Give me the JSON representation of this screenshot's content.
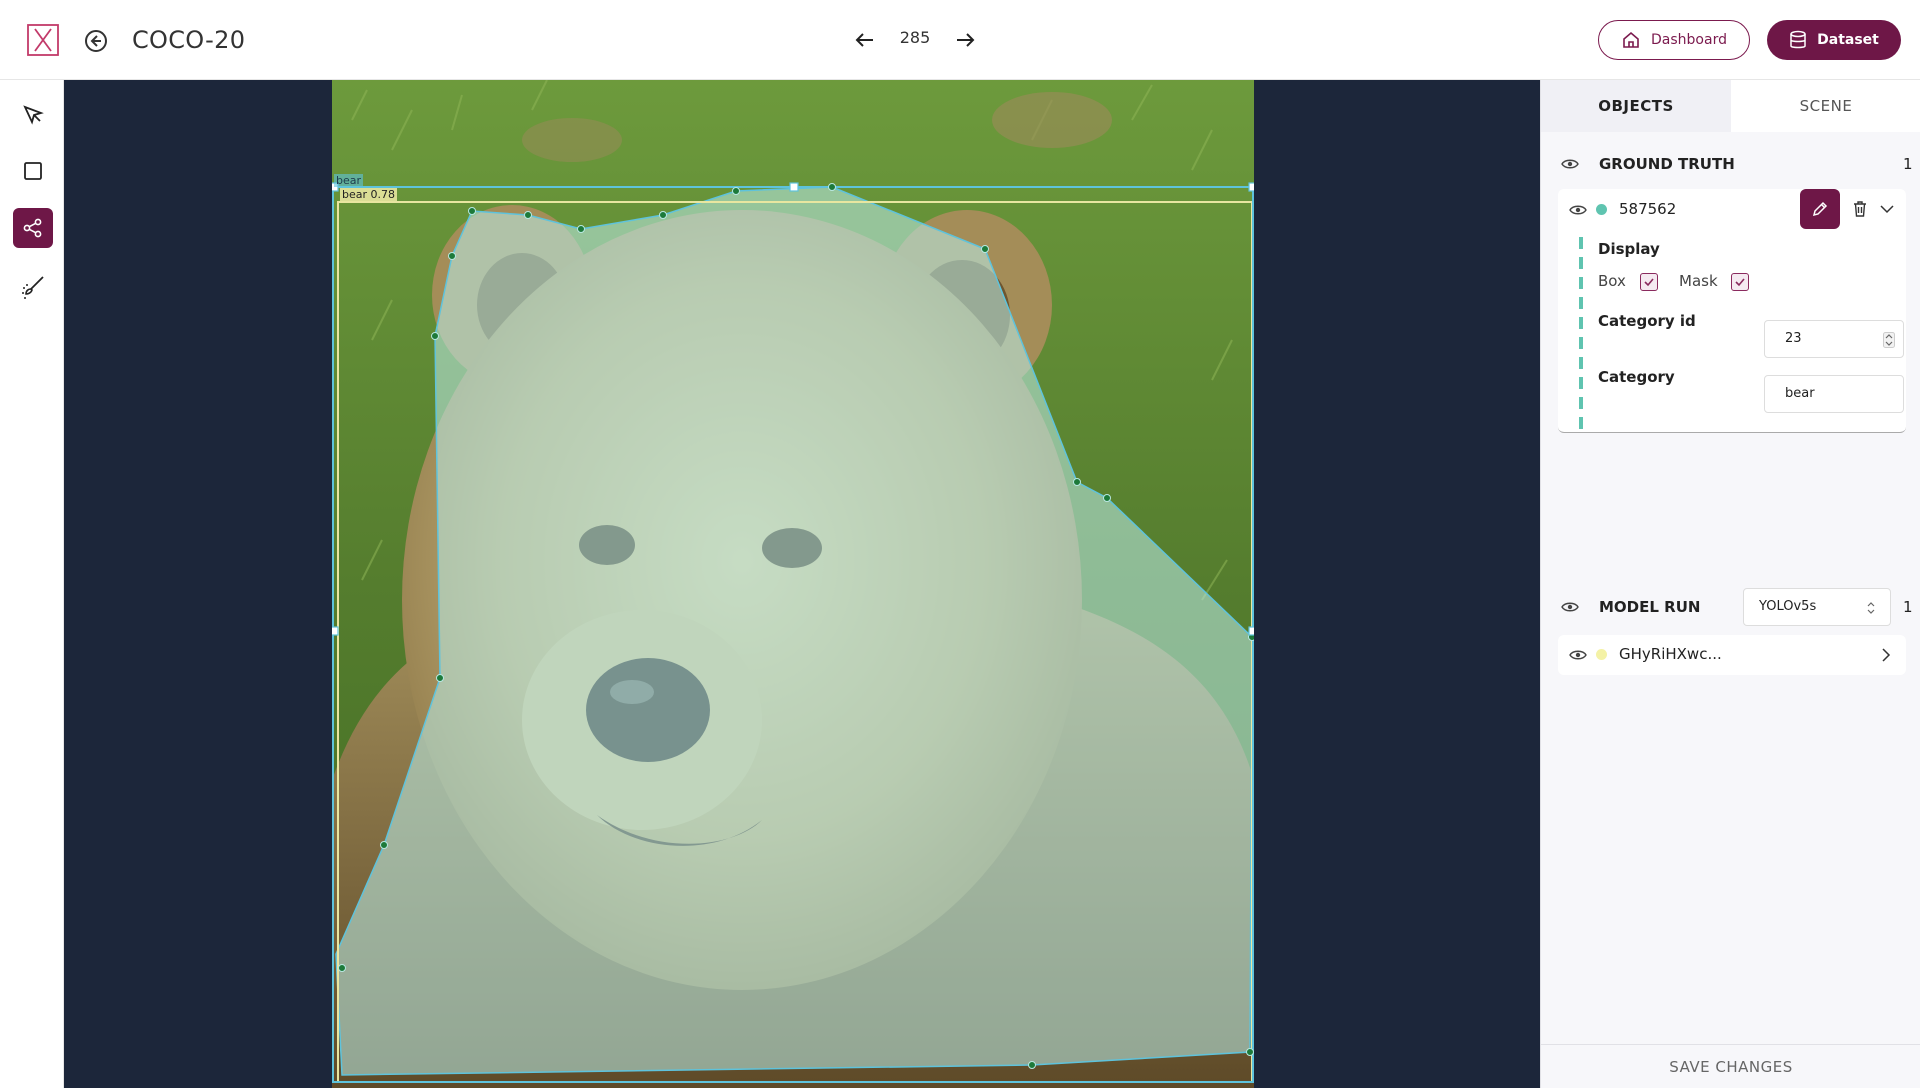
{
  "header": {
    "title": "COCO-20",
    "item_index": "285",
    "dashboard_label": "Dashboard",
    "dataset_label": "Dataset"
  },
  "toolbar": {
    "tools": [
      "pointer-icon",
      "bounding-box-icon",
      "polygon-icon",
      "brush-icon"
    ],
    "active_tool": "polygon-icon"
  },
  "canvas": {
    "gt_label": "bear",
    "pred_label": "bear 0.78"
  },
  "panel": {
    "tabs": [
      "OBJECTS",
      "SCENE"
    ],
    "active_tab": "OBJECTS",
    "ground_truth": {
      "title": "GROUND TRUTH",
      "count": "1",
      "object": {
        "id": "587562",
        "color": "#5fc4b0",
        "display_label": "Display",
        "box_label": "Box",
        "box_checked": true,
        "mask_label": "Mask",
        "mask_checked": true,
        "category_id_label": "Category id",
        "category_id_value": "23",
        "category_label": "Category",
        "category_value": "bear"
      }
    },
    "model_run": {
      "title": "MODEL RUN",
      "model": "YOLOv5s",
      "count": "1",
      "object": {
        "id": "GHyRiHXwc...",
        "color": "#f4f2a6"
      }
    },
    "save_label": "SAVE CHANGES"
  },
  "colors": {
    "accent": "#6e1747",
    "canvas_bg": "#1c263a",
    "gt_box": "#5ec3dc",
    "pred_box": "#e8e6a0",
    "mask_fill": "#b8e8e2"
  }
}
